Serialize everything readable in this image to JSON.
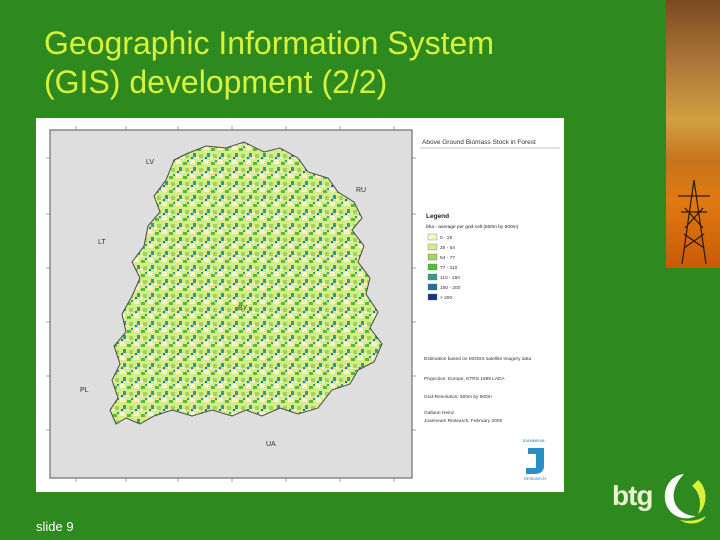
{
  "slide": {
    "title_line1": "Geographic Information System",
    "title_line2": "(GIS) development (2/2)",
    "number": "slide 9",
    "brand": "btg"
  },
  "map": {
    "title": "Above Ground Biomass Stock in Forest",
    "countries": {
      "lv": "LV",
      "ru": "RU",
      "lt": "LT",
      "by": "BY",
      "pl": "PL",
      "ua": "UA"
    },
    "legend": {
      "title": "Legend",
      "subtitle": "bha - average per grid-cell (500m by 500m)",
      "classes": [
        {
          "label": "0 - 25",
          "color": "#f6f7c8"
        },
        {
          "label": "25 - 54",
          "color": "#d6ec8a"
        },
        {
          "label": "54 - 77",
          "color": "#9fd65a"
        },
        {
          "label": "77 - 110",
          "color": "#4fbf3a"
        },
        {
          "label": "110 - 150",
          "color": "#2e9c8a"
        },
        {
          "label": "150 - 200",
          "color": "#1f6fa0"
        },
        {
          "label": "> 200",
          "color": "#1a2f86"
        }
      ]
    },
    "notes": {
      "basis": "Estimation based on MODIS satellite imagery data",
      "projection": "Projection: Europe, ETRS 1989 LAEA",
      "resolution": "Grid-Resolution: 500m by 500m",
      "author": "Gallaun Heinz",
      "org_date": "Joanneum Research, February 2008",
      "logo_top": "JOANNEUM",
      "logo_bottom": "RESEARCH"
    }
  }
}
